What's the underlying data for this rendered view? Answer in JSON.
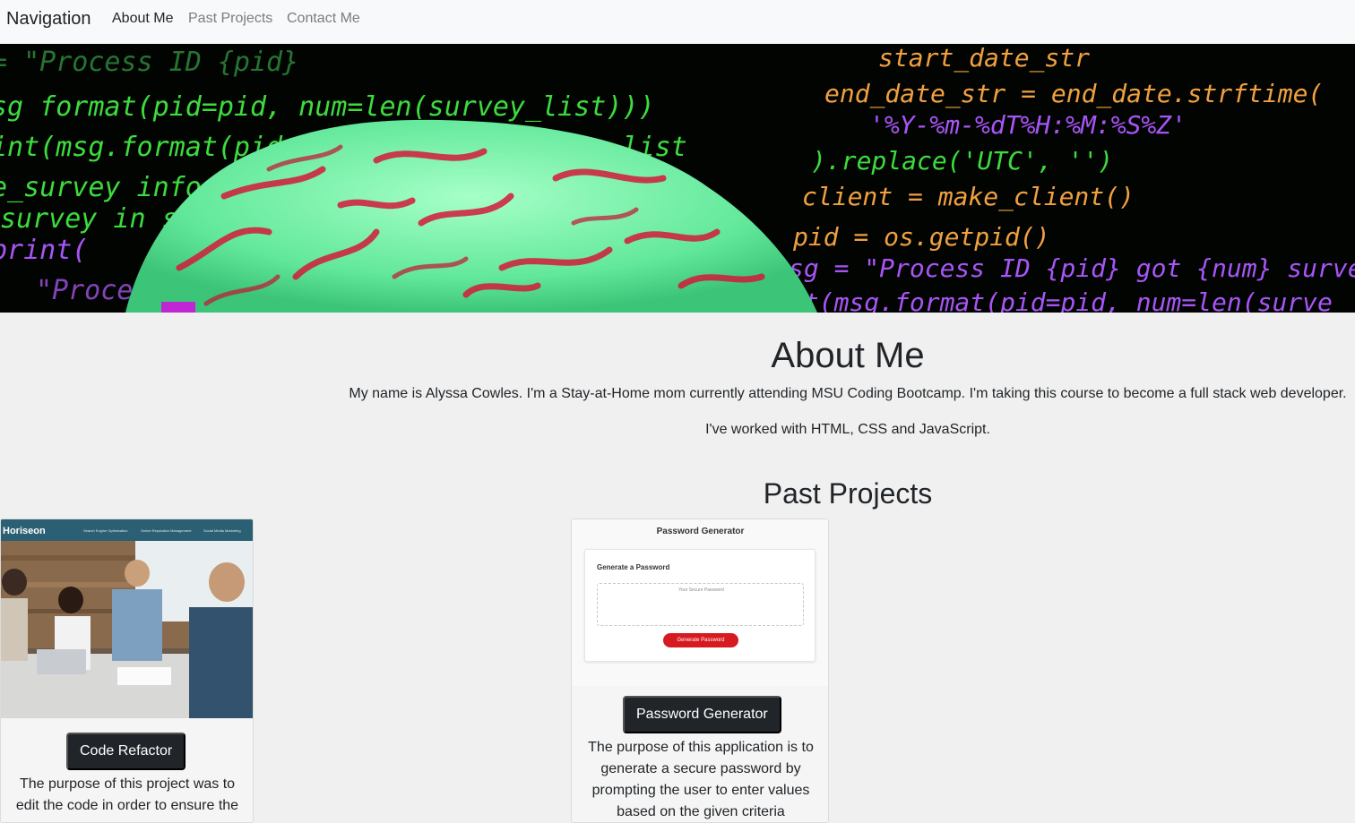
{
  "nav": {
    "brand": "Navigation",
    "links": [
      {
        "label": "About Me",
        "active": true
      },
      {
        "label": "Past Projects",
        "active": false
      },
      {
        "label": "Contact Me",
        "active": false
      }
    ]
  },
  "hero": {
    "code_lines_left": [
      "= \"Process ID {pid}",
      "sg    format(pid=pid, num=len(survey_list)))",
      "int(msg.format(pid=pid, num=len(survey_list",
      "e_survey info(survey_list, pid)",
      "survey in survey_list:",
      "print(",
      "\"Processing",
      "n=sur"
    ],
    "code_lines_right": [
      "start_date_str",
      "end_date_str = end_date.strftime(",
      "'%Y-%m-%dT%H:%M:%S%Z'",
      ").replace('UTC', '')",
      "client = make_client()",
      "pid = os.getpid()",
      "sg = \"Process ID {pid} got {num} surve",
      "nt(msg.format(pid=pid, num=len(surve"
    ],
    "colors": {
      "green": "#3ddc3d",
      "orange": "#f0a040",
      "purple": "#a855f7",
      "brain": "#7af5a8",
      "brain_red": "#d21a3a"
    }
  },
  "about": {
    "title": "About Me",
    "paragraph1": "My name is Alyssa Cowles. I'm a Stay-at-Home mom currently attending MSU Coding Bootcamp. I'm taking this course to become a full stack web developer.",
    "paragraph2": "I've worked with HTML, CSS and JavaScript."
  },
  "projects": {
    "title": "Past Projects",
    "items": [
      {
        "button": "Code Refactor",
        "description": "The purpose of this project was to edit the code in order to ensure the",
        "thumb": {
          "brand": "Horiseon",
          "nav": [
            "Search Engine Optimization",
            "Online Reputation Management",
            "Social Media Marketing"
          ]
        }
      },
      {
        "button": "Password Generator",
        "description": "The purpose of this application is to generate a secure password by prompting the user to enter values based on the given criteria",
        "thumb": {
          "title": "Password Generator",
          "subtitle": "Generate a Password",
          "placeholder": "Your Secure Password",
          "button": "Generate Password"
        }
      }
    ]
  }
}
